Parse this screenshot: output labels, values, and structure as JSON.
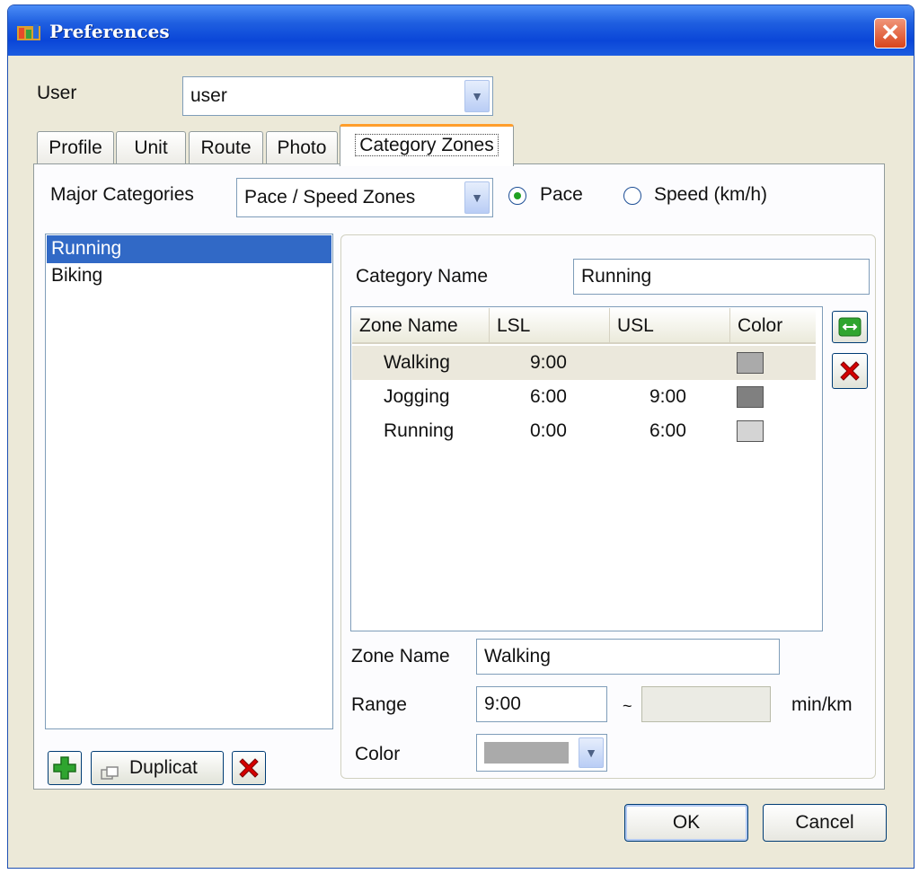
{
  "window": {
    "title": "Preferences",
    "close_glyph": "✕"
  },
  "user": {
    "label": "User",
    "value": "user"
  },
  "tabs": [
    {
      "label": "Profile"
    },
    {
      "label": "Unit"
    },
    {
      "label": "Route"
    },
    {
      "label": "Photo"
    },
    {
      "label": "Category Zones",
      "active": true
    }
  ],
  "major_categories": {
    "label": "Major Categories",
    "value": "Pace / Speed Zones",
    "options": [
      {
        "label": "Pace",
        "selected": true
      },
      {
        "label": "Speed (km/h)",
        "selected": false
      }
    ]
  },
  "category_list": {
    "items": [
      {
        "label": "Running",
        "selected": true
      },
      {
        "label": "Biking",
        "selected": false
      }
    ],
    "duplicate_label": "Duplicat"
  },
  "category_name": {
    "label": "Category Name",
    "value": "Running"
  },
  "zones": {
    "headers": [
      "Zone Name",
      "LSL",
      "USL",
      "Color"
    ],
    "rows": [
      {
        "name": "Walking",
        "lsl": "9:00",
        "usl": "",
        "color": "#aaaaaa",
        "selected": true
      },
      {
        "name": "Jogging",
        "lsl": "6:00",
        "usl": "9:00",
        "color": "#808080",
        "selected": false
      },
      {
        "name": "Running",
        "lsl": "0:00",
        "usl": "6:00",
        "color": "#d4d4d4",
        "selected": false
      }
    ]
  },
  "zone_edit": {
    "name_label": "Zone Name",
    "name_value": "Walking",
    "range_label": "Range",
    "range_from": "9:00",
    "range_sep": "~",
    "range_to": "",
    "unit": "min/km",
    "color_label": "Color",
    "color_value": "#aaaaaa"
  },
  "buttons": {
    "ok": "OK",
    "cancel": "Cancel"
  },
  "colors": {
    "title_bar": "#0a46d8",
    "selection": "#3169c6",
    "dialog_bg": "#ece9d8",
    "add_green": "#2fa52f",
    "delete_red": "#d60000"
  }
}
